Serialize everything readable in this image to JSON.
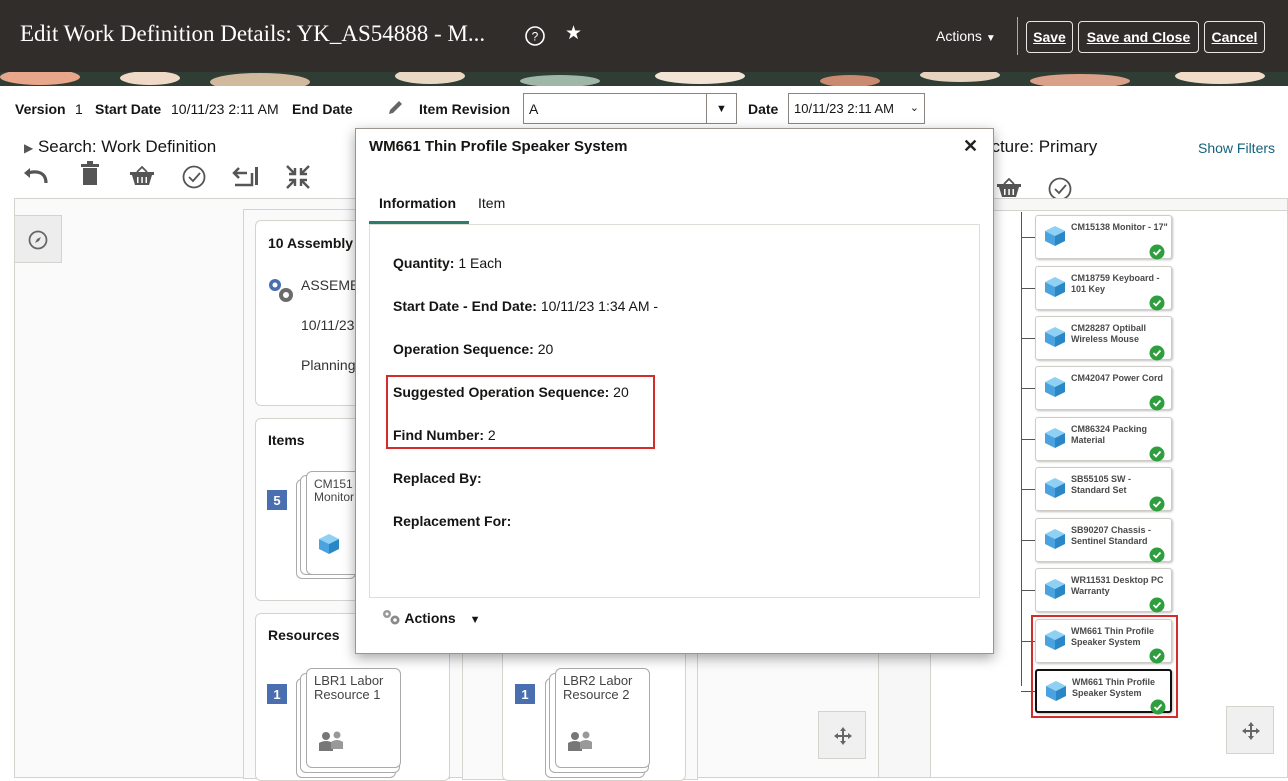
{
  "header": {
    "title": "Edit Work Definition Details: YK_AS54888 - M...",
    "actions_label": "Actions",
    "save_label": "Save",
    "save_close_label": "Save and Close",
    "cancel_label": "Cancel"
  },
  "details": {
    "version_label": "Version",
    "version_value": "1",
    "start_date_label": "Start Date",
    "start_date_value": "10/11/23 2:11 AM",
    "end_date_label": "End Date",
    "item_revision_label": "Item Revision",
    "item_revision_value": "A",
    "date_label": "Date",
    "date_value": "10/11/23 2:11 AM"
  },
  "search": {
    "label": "Search: Work Definition"
  },
  "structure": {
    "title_partial": "ucture: Primary",
    "show_filters": "Show Filters"
  },
  "operations": {
    "assembly_title": "10 Assembly",
    "assembly_text": "ASSEMB",
    "date_text": "10/11/23",
    "planning_text": "Planning",
    "items_title": "Items",
    "items_count": "5",
    "item_card": "CM151 Monitor",
    "resources_title": "Resources",
    "res1_count": "1",
    "res1_label": "LBR1 Labor Resource 1",
    "res2_count": "1",
    "res2_label": "LBR2 Labor Resource 2"
  },
  "tree_nodes": [
    {
      "label": "CM15138 Monitor - 17\""
    },
    {
      "label": "CM18759 Keyboard - 101 Key"
    },
    {
      "label": "CM28287 Optiball Wireless Mouse"
    },
    {
      "label": "CM42047 Power Cord"
    },
    {
      "label": "CM86324 Packing Material"
    },
    {
      "label": "SB55105 SW - Standard Set"
    },
    {
      "label": "SB90207 Chassis - Sentinel Standard"
    },
    {
      "label": "WR11531 Desktop PC Warranty"
    },
    {
      "label": "WM661 Thin Profile Speaker System"
    },
    {
      "label": "WM661 Thin Profile Speaker System"
    }
  ],
  "popup": {
    "title": "WM661 Thin Profile Speaker System",
    "tabs": [
      "Information",
      "Item"
    ],
    "quantity_label": "Quantity:",
    "quantity_value": "1 Each",
    "dates_label": "Start Date - End Date:",
    "dates_value": "10/11/23 1:34 AM -",
    "opseq_label": "Operation Sequence:",
    "opseq_value": "20",
    "sugg_label": "Suggested Operation Sequence:",
    "sugg_value": "20",
    "find_label": "Find Number:",
    "find_value": "2",
    "replaced_label": "Replaced By:",
    "replacement_label": "Replacement For:",
    "actions_label": "Actions"
  },
  "colors": {
    "header_bg": "#302d2a",
    "highlight": "#d62b2b",
    "badge": "#4a6fb0",
    "check": "#2e9e3e",
    "cube": "#4aa3df"
  },
  "icons": [
    "help-icon",
    "star-icon",
    "chevron-down-icon",
    "pencil-icon",
    "undo-icon",
    "trash-icon",
    "basket-icon",
    "check-circle-icon",
    "return-icon",
    "collapse-icon",
    "compass-icon",
    "gear-icon",
    "cube-icon",
    "people-icon",
    "close-icon",
    "move-icon"
  ]
}
